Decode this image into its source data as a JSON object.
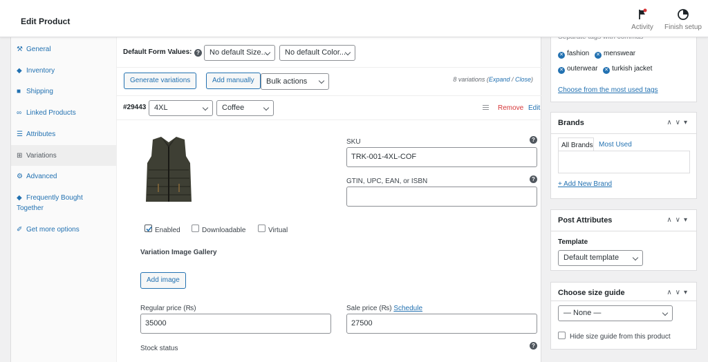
{
  "header": {
    "title": "Edit Product",
    "activity_label": "Activity",
    "finish_setup_label": "Finish setup"
  },
  "tabs": [
    {
      "label": "General",
      "icon": "wrench-icon"
    },
    {
      "label": "Inventory",
      "icon": "tag-icon"
    },
    {
      "label": "Shipping",
      "icon": "truck-icon"
    },
    {
      "label": "Linked Products",
      "icon": "link-icon"
    },
    {
      "label": "Attributes",
      "icon": "list-icon"
    },
    {
      "label": "Variations",
      "icon": "grid-icon"
    },
    {
      "label": "Advanced",
      "icon": "gear-icon"
    },
    {
      "label": "Frequently Bought Together",
      "icon": "tag-icon"
    },
    {
      "label": "Get more options",
      "icon": "plugin-icon"
    }
  ],
  "defaults": {
    "label": "Default Form Values:",
    "size": "No default Size...",
    "color": "No default Color..."
  },
  "actions": {
    "generate": "Generate variations",
    "add_manually": "Add manually",
    "bulk": "Bulk actions",
    "count_text": "8 variations (",
    "expand": "Expand",
    "sep": " / ",
    "close": "Close",
    "end": ")"
  },
  "variation": {
    "id": "#29443",
    "size": "4XL",
    "color": "Coffee",
    "remove": "Remove",
    "edit": "Edit",
    "sku_label": "SKU",
    "sku_value": "TRK-001-4XL-COF",
    "gtin_label": "GTIN, UPC, EAN, or ISBN",
    "gtin_value": "",
    "enabled": "Enabled",
    "downloadable": "Downloadable",
    "virtual": "Virtual",
    "gallery_label": "Variation Image Gallery",
    "add_image": "Add image",
    "regular_label": "Regular price (₨)",
    "regular_value": "35000",
    "sale_label": "Sale price (₨) ",
    "schedule": "Schedule",
    "sale_value": "27500",
    "stock_label": "Stock status"
  },
  "tags_box": {
    "hint": "Separate tags with commas",
    "tags": [
      "fashion",
      "menswear",
      "outerwear",
      "turkish jacket"
    ],
    "choose": "Choose from the most used tags"
  },
  "brands_box": {
    "title": "Brands",
    "tab_all": "All Brands",
    "tab_most": "Most Used",
    "add_new": "+ Add New Brand"
  },
  "post_attr_box": {
    "title": "Post Attributes",
    "template_label": "Template",
    "template_value": "Default template"
  },
  "size_guide_box": {
    "title": "Choose size guide",
    "select_value": "— None —",
    "hide_label": "Hide size guide from this product"
  },
  "colors": {
    "accent": "#2271b1",
    "danger": "#d63638",
    "vest": "#3e3f34"
  }
}
